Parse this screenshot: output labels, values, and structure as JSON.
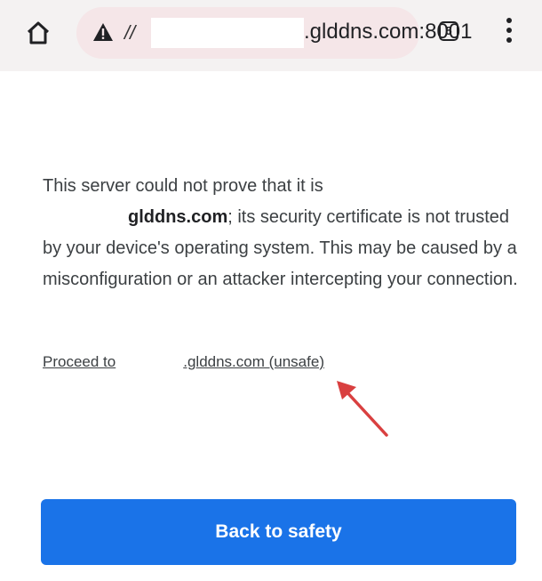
{
  "browser": {
    "url_scheme": "//",
    "url_host": ".glddns.com:8001",
    "tab_count": "5",
    "icons": {
      "home": "home-icon",
      "warning": "warning-triangle-icon",
      "tabs": "tab-switcher-icon",
      "menu": "more-vert-icon"
    }
  },
  "interstitial": {
    "line1": "This server could not prove that it is",
    "host": "glddns.com",
    "line2_rest": "; its security certificate is not trusted by your device's operating system. This may be caused by a misconfiguration or an attacker intercepting your connection.",
    "proceed_prefix": "Proceed to",
    "proceed_suffix": ".glddns.com (unsafe)",
    "back_button": "Back to safety",
    "annotation": "red-arrow-annotation"
  },
  "colors": {
    "primary_button": "#1a73e8",
    "omnibox_warning": "#f5e6e8",
    "annotation_arrow": "#d94040"
  }
}
